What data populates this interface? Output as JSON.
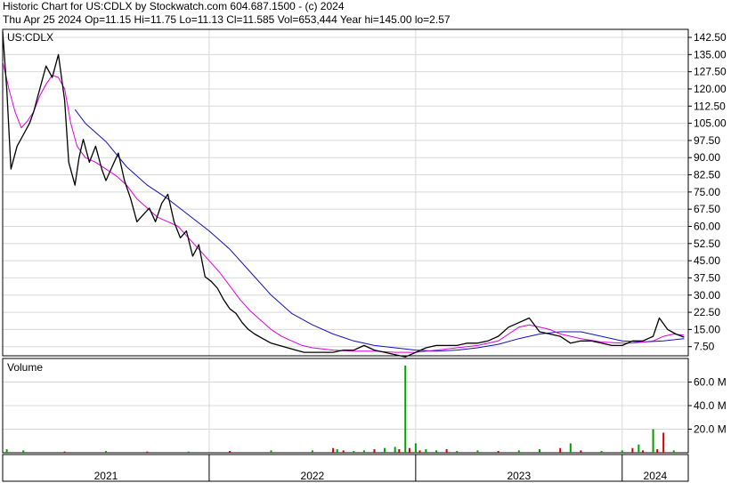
{
  "header": {
    "line1": "Historic Chart for US:CDLX by Stockwatch.com 604.687.1500 - (c) 2024",
    "line2": "Thu Apr 25 2024   Op=11.15   Hi=11.75   Lo=11.13   Cl=11.585   Vol=653,444   Year hi=145.00   lo=2.57"
  },
  "colors": {
    "price": "#000000",
    "ma_short": "#e000e0",
    "ma_long": "#1010c0",
    "volume_up": "#00a000",
    "volume_down": "#d00000",
    "grid": "#d8d8d8",
    "frame": "#000000"
  },
  "chart_data": [
    {
      "type": "line",
      "symbol_label": "US:CDLX",
      "ylim": [
        3.5,
        146
      ],
      "y_ticks": [
        "142.50",
        "135.00",
        "127.50",
        "120.00",
        "112.50",
        "105.00",
        "97.50",
        "90.00",
        "82.50",
        "75.00",
        "67.50",
        "60.00",
        "52.50",
        "45.00",
        "37.50",
        "30.00",
        "22.50",
        "15.00",
        "7.50"
      ],
      "y_tick_values": [
        142.5,
        135,
        127.5,
        120,
        112.5,
        105,
        97.5,
        90,
        82.5,
        75,
        67.5,
        60,
        52.5,
        45,
        37.5,
        30,
        22.5,
        15,
        7.5
      ],
      "xlim": [
        2021.0,
        2024.32
      ],
      "x_ticks": [
        "2021",
        "2022",
        "2023",
        "2024"
      ],
      "x_tick_positions": [
        2021.0,
        2022.0,
        2023.0,
        2024.0
      ],
      "x_label_positions": [
        2021.5,
        2022.5,
        2023.5,
        2024.16
      ],
      "series": [
        {
          "key": "price",
          "x": [
            2021.0,
            2021.02,
            2021.04,
            2021.07,
            2021.1,
            2021.13,
            2021.15,
            2021.18,
            2021.21,
            2021.24,
            2021.27,
            2021.3,
            2021.32,
            2021.35,
            2021.37,
            2021.39,
            2021.42,
            2021.45,
            2021.48,
            2021.5,
            2021.53,
            2021.56,
            2021.59,
            2021.62,
            2021.65,
            2021.68,
            2021.71,
            2021.74,
            2021.77,
            2021.8,
            2021.83,
            2021.86,
            2021.89,
            2021.92,
            2021.95,
            2021.98,
            2022.01,
            2022.04,
            2022.07,
            2022.1,
            2022.13,
            2022.16,
            2022.19,
            2022.22,
            2022.26,
            2022.3,
            2022.34,
            2022.38,
            2022.42,
            2022.46,
            2022.5,
            2022.55,
            2022.6,
            2022.65,
            2022.7,
            2022.75,
            2022.8,
            2022.85,
            2022.9,
            2022.95,
            2023.0,
            2023.05,
            2023.1,
            2023.15,
            2023.2,
            2023.25,
            2023.3,
            2023.35,
            2023.4,
            2023.45,
            2023.5,
            2023.55,
            2023.6,
            2023.65,
            2023.7,
            2023.75,
            2023.8,
            2023.85,
            2023.9,
            2023.95,
            2024.0,
            2024.05,
            2024.1,
            2024.15,
            2024.18,
            2024.22,
            2024.26,
            2024.3
          ],
          "values": [
            145,
            120,
            85,
            95,
            100,
            105,
            110,
            120,
            130,
            125,
            135,
            115,
            88,
            78,
            90,
            98,
            88,
            95,
            85,
            80,
            86,
            92,
            80,
            72,
            62,
            65,
            68,
            62,
            70,
            74,
            62,
            55,
            58,
            47,
            52,
            38,
            36,
            33,
            28,
            24,
            22,
            18,
            15,
            13,
            11,
            9,
            8,
            7,
            6,
            5,
            5,
            5,
            5,
            6,
            6,
            8,
            6,
            5,
            4,
            3,
            5,
            7,
            8,
            8,
            8,
            9,
            9,
            10,
            12,
            16,
            18,
            20,
            14,
            13,
            12,
            9,
            10,
            10,
            9,
            8,
            8,
            10,
            10,
            12,
            20,
            15,
            13,
            11.6
          ]
        },
        {
          "key": "ma_short",
          "x": [
            2021.0,
            2021.03,
            2021.06,
            2021.09,
            2021.12,
            2021.15,
            2021.18,
            2021.21,
            2021.24,
            2021.27,
            2021.3,
            2021.33,
            2021.36,
            2021.4,
            2021.45,
            2021.5,
            2021.55,
            2021.6,
            2021.65,
            2021.7,
            2021.75,
            2021.8,
            2021.85,
            2021.9,
            2021.95,
            2022.0,
            2022.05,
            2022.1,
            2022.15,
            2022.2,
            2022.25,
            2022.3,
            2022.35,
            2022.4,
            2022.45,
            2022.5,
            2022.6,
            2022.7,
            2022.8,
            2022.9,
            2023.0,
            2023.1,
            2023.2,
            2023.3,
            2023.4,
            2023.45,
            2023.5,
            2023.55,
            2023.6,
            2023.65,
            2023.7,
            2023.8,
            2023.9,
            2024.0,
            2024.05,
            2024.1,
            2024.15,
            2024.2,
            2024.25,
            2024.3
          ],
          "values": [
            132,
            120,
            110,
            103,
            106,
            110,
            117,
            122,
            126,
            125,
            120,
            105,
            95,
            90,
            88,
            85,
            82,
            78,
            72,
            68,
            64,
            62,
            60,
            55,
            50,
            45,
            40,
            34,
            28,
            23,
            19,
            15,
            12,
            10,
            8,
            7,
            6,
            5.5,
            5.5,
            5,
            5,
            6,
            7,
            8,
            10,
            13,
            16,
            17,
            16,
            15,
            13,
            11,
            9.5,
            9,
            9,
            9.5,
            10,
            12,
            13,
            12.5
          ]
        },
        {
          "key": "ma_long",
          "x": [
            2021.35,
            2021.4,
            2021.5,
            2021.6,
            2021.7,
            2021.8,
            2021.9,
            2022.0,
            2022.1,
            2022.2,
            2022.3,
            2022.4,
            2022.5,
            2022.6,
            2022.7,
            2022.8,
            2022.9,
            2023.0,
            2023.1,
            2023.2,
            2023.3,
            2023.4,
            2023.5,
            2023.6,
            2023.7,
            2023.8,
            2023.9,
            2024.0,
            2024.1,
            2024.2,
            2024.3
          ],
          "values": [
            111,
            105,
            97,
            86,
            78,
            72,
            65,
            58,
            50,
            40,
            30,
            22,
            17,
            13,
            10,
            8,
            7,
            6,
            5.5,
            6,
            7,
            8.5,
            11,
            13,
            14,
            14,
            12,
            10,
            9.5,
            10,
            11
          ]
        }
      ]
    },
    {
      "type": "bar",
      "title": "Volume",
      "y_ticks": [
        "60.0 M",
        "40.0 M",
        "20.0 M"
      ],
      "y_tick_values": [
        60,
        40,
        20
      ],
      "ylim": [
        0,
        80
      ],
      "xlim": [
        2021.0,
        2024.32
      ],
      "x": [
        2021.02,
        2021.1,
        2021.3,
        2021.5,
        2021.7,
        2021.9,
        2022.1,
        2022.3,
        2022.5,
        2022.6,
        2022.62,
        2022.65,
        2022.7,
        2022.75,
        2022.8,
        2022.85,
        2022.9,
        2022.92,
        2022.95,
        2022.97,
        2023.0,
        2023.02,
        2023.05,
        2023.1,
        2023.15,
        2023.2,
        2023.3,
        2023.4,
        2023.5,
        2023.6,
        2023.7,
        2023.75,
        2023.8,
        2023.9,
        2024.0,
        2024.05,
        2024.08,
        2024.1,
        2024.15,
        2024.17,
        2024.2,
        2024.25
      ],
      "values": [
        3,
        2,
        1,
        1.5,
        1,
        1,
        1.5,
        2,
        2,
        4,
        3,
        2,
        1.5,
        2,
        3,
        4,
        5,
        3,
        74,
        4,
        8,
        2,
        3,
        2,
        3,
        1.5,
        2,
        1.5,
        2,
        3,
        4,
        8,
        2,
        1.5,
        2,
        4,
        7,
        2,
        20,
        3,
        17,
        2
      ],
      "up": [
        true,
        true,
        false,
        true,
        false,
        true,
        false,
        true,
        true,
        false,
        true,
        false,
        true,
        true,
        false,
        true,
        true,
        false,
        true,
        false,
        true,
        false,
        true,
        true,
        false,
        true,
        true,
        false,
        true,
        true,
        false,
        true,
        false,
        true,
        true,
        false,
        true,
        false,
        true,
        false,
        false,
        true
      ]
    }
  ]
}
